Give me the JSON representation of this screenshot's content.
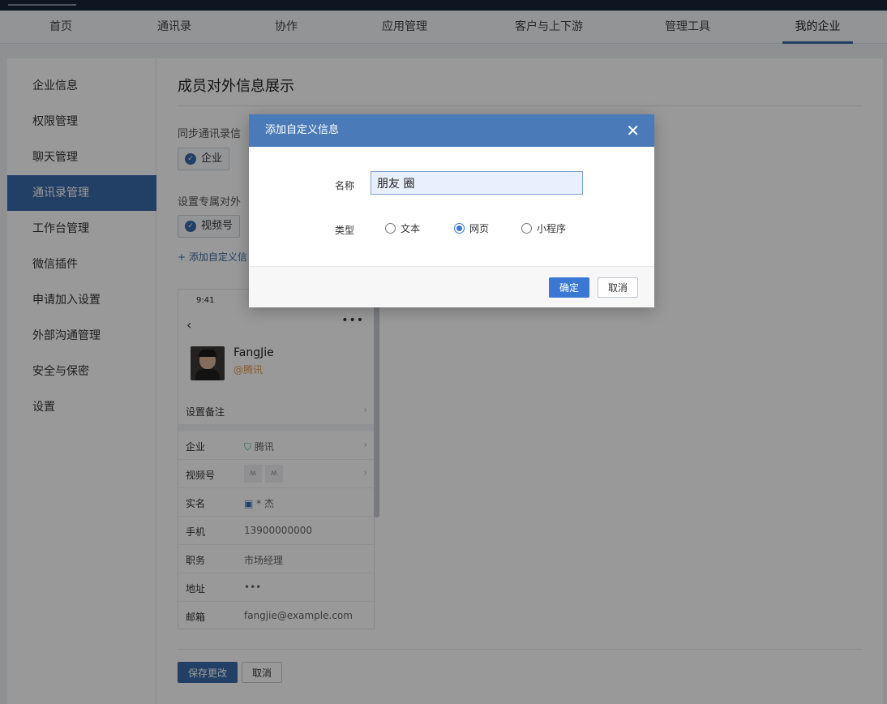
{
  "nav": {
    "items": [
      "首页",
      "通讯录",
      "协作",
      "应用管理",
      "客户与上下游",
      "管理工具",
      "我的企业"
    ],
    "active": "我的企业"
  },
  "sidebar": {
    "items": [
      "企业信息",
      "权限管理",
      "聊天管理",
      "通讯录管理",
      "工作台管理",
      "微信插件",
      "申请加入设置",
      "外部沟通管理",
      "安全与保密",
      "设置"
    ],
    "active": "通讯录管理"
  },
  "main": {
    "title": "成员对外信息展示",
    "sync_label": "同步通讯录信",
    "sync_chip": "企业",
    "custom_label": "设置专属对外",
    "custom_chip": "视频号",
    "add_link": "+ 添加自定义信",
    "save_button": "保存更改",
    "cancel_button": "取消"
  },
  "preview": {
    "time": "9:41",
    "name": "FangJie",
    "corp": "@腾讯",
    "remark_label": "设置备注",
    "rows": [
      {
        "k": "企业",
        "v": "腾讯"
      },
      {
        "k": "视频号",
        "v": ""
      },
      {
        "k": "实名",
        "v": "* 杰"
      },
      {
        "k": "手机",
        "v": "13900000000"
      },
      {
        "k": "职务",
        "v": "市场经理"
      },
      {
        "k": "地址",
        "v": "•••"
      },
      {
        "k": "邮箱",
        "v": "fangjie@example.com"
      }
    ]
  },
  "modal": {
    "title": "添加自定义信息",
    "close": "✕",
    "name_label": "名称",
    "name_value": "朋友 圈",
    "type_label": "类型",
    "options": [
      "文本",
      "网页",
      "小程序"
    ],
    "selected": "网页",
    "ok": "确定",
    "cancel": "取消"
  },
  "colors": {
    "accent": "#3a6aa8",
    "modal_header": "#4a7bb8",
    "primary_button": "#3a78d6",
    "corp_orange": "#e5984a"
  }
}
